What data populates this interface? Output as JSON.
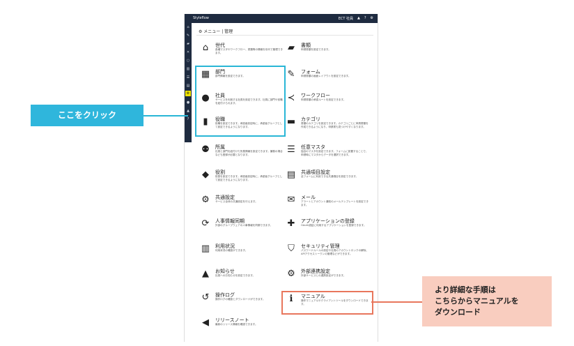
{
  "topbar": {
    "logo": "Styleflow",
    "user": "ECT 社員",
    "icons": [
      "bell-icon",
      "question-icon",
      "gear-icon"
    ]
  },
  "breadcrumb": "メニュー | 管理",
  "left_items": [
    {
      "name": "sedai",
      "icon": "home-icon",
      "glyph": "⌂",
      "title": "世代",
      "desc": "各種マスタやワークフロー、書類等の情報を世代で管理できます。"
    },
    {
      "name": "bumon",
      "icon": "building-icon",
      "glyph": "▦",
      "title": "部門",
      "desc": "部門情報を設定できます。"
    },
    {
      "name": "shain",
      "icon": "person-icon",
      "glyph": "●",
      "title": "社員",
      "desc": "サービスを利用する社員を設定できます。社員に部門や役職を紐付けられます。"
    },
    {
      "name": "yakushoku",
      "icon": "badge-icon",
      "glyph": "▮",
      "title": "役職",
      "desc": "役職を設定できます。承認者設定時に、承認者グループとして設定できるようになります。"
    },
    {
      "name": "shozoku",
      "icon": "group-icon",
      "glyph": "⚉",
      "title": "所属",
      "desc": "社員と部門を紐付けた所属情報を設定できます。兼務の場合なども登録が必要となります。"
    },
    {
      "name": "yakuwari",
      "icon": "tag-icon",
      "glyph": "◆",
      "title": "役割",
      "desc": "役割を設定できます。承認者設定時に、承認者グループとして設定できるようになります。"
    },
    {
      "name": "kyotsu",
      "icon": "gear-icon",
      "glyph": "⚙",
      "title": "共通設定",
      "desc": "サービス全体の共通設定を行えます。"
    },
    {
      "name": "jinji",
      "icon": "sync-icon",
      "glyph": "⟳",
      "title": "人事情報同期",
      "desc": "外部のグループウェアの人事情報を同期できます。"
    },
    {
      "name": "riyou",
      "icon": "chart-icon",
      "glyph": "▥",
      "title": "利用状況",
      "desc": "利用状況の確認ができます。"
    },
    {
      "name": "oshirase",
      "icon": "bell-icon",
      "glyph": "▲",
      "title": "お知らせ",
      "desc": "社員へのお知らせを設定できます。"
    },
    {
      "name": "log",
      "icon": "history-icon",
      "glyph": "↺",
      "title": "操作ログ",
      "desc": "操作ログの確認とダウンロードができます。"
    },
    {
      "name": "release",
      "icon": "megaphone-icon",
      "glyph": "◀",
      "title": "リリースノート",
      "desc": "最新のリリース情報を確認できます。"
    }
  ],
  "right_items": [
    {
      "name": "shorui",
      "icon": "book-icon",
      "glyph": "▰",
      "title": "書類",
      "desc": "申請書類を設定できます。"
    },
    {
      "name": "form",
      "icon": "edit-icon",
      "glyph": "✎",
      "title": "フォーム",
      "desc": "申請書類の画面レイアウトを設定できます。"
    },
    {
      "name": "workflow",
      "icon": "share-icon",
      "glyph": "≺",
      "title": "ワークフロー",
      "desc": "申請書類の承認ルートを設定できます。"
    },
    {
      "name": "category",
      "icon": "folder-icon",
      "glyph": "▬",
      "title": "カテゴリ",
      "desc": "書類のカテゴリを設定できます。カテゴリごとに申請書類を作成できるようになり、申請書も見つけやすくなります。"
    },
    {
      "name": "nini",
      "icon": "list-icon",
      "glyph": "☰",
      "title": "任意マスタ",
      "desc": "独自のマスタを設定できます。フォームに設置することで、申請時にマスタからデータを選択できます。"
    },
    {
      "name": "kyotsu-item",
      "icon": "card-icon",
      "glyph": "▤",
      "title": "共通項目設定",
      "desc": "全フォームに利用できる共通項目を設定できます。"
    },
    {
      "name": "mail",
      "icon": "mail-icon",
      "glyph": "✉",
      "title": "メール",
      "desc": "アラートとアカウント通知のメールテンプレートを設定できます。"
    },
    {
      "name": "app",
      "icon": "plus-icon",
      "glyph": "✚",
      "title": "アプリケーションの登録",
      "desc": "OAuth認証に利用するアプリケーションを登録できます。"
    },
    {
      "name": "security",
      "icon": "shield-icon",
      "glyph": "⛉",
      "title": "セキュリティ管理",
      "desc": "パスワードルールの設定や社員のアカウントロックの解除、APIアクセストークンの管理などができます。"
    },
    {
      "name": "gaibu",
      "icon": "gear-icon",
      "glyph": "⚙",
      "title": "外部連携設定",
      "desc": "外部サービスとの連携設定ができます。"
    },
    {
      "name": "manual",
      "icon": "info-icon",
      "glyph": "ℹ",
      "title": "マニュアル",
      "desc": "操作マニュアルやクライアントツールをダウンロードできます。"
    }
  ],
  "callouts": {
    "click_here": "ここをクリック",
    "manual_note": [
      "より詳細な手順は",
      "こちらからマニュアルを",
      "ダウンロード"
    ]
  },
  "colors": {
    "accent_blue": "#29b6d6",
    "accent_orange": "#e8765c",
    "nav_dark": "#1e2b40",
    "active_yellow": "#f2e600"
  }
}
